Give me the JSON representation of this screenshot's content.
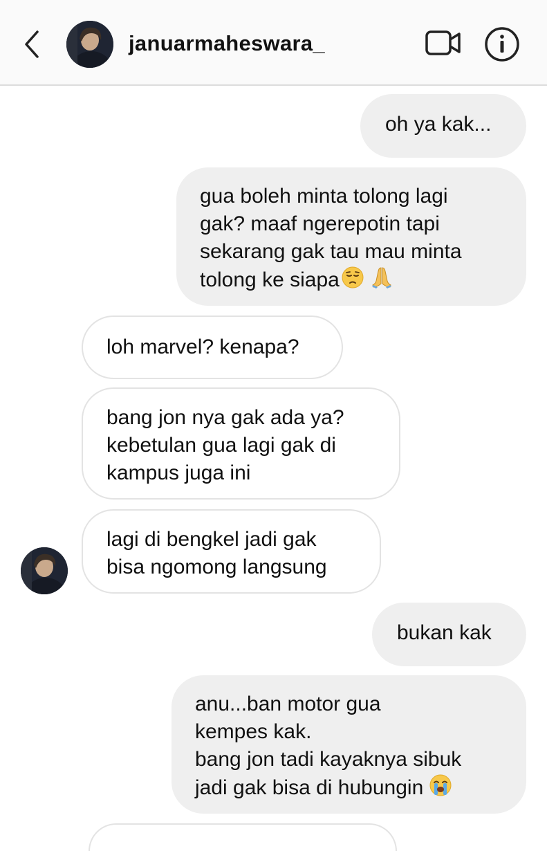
{
  "header": {
    "username": "januarmaheswara_",
    "icons": [
      "chevron-left-icon",
      "video-camera-icon",
      "info-icon"
    ]
  },
  "messages": [
    {
      "from": "me",
      "lines": [
        "oh ya kak..."
      ]
    },
    {
      "from": "me",
      "lines": [
        "gua boleh minta tolong lagi",
        "gak? maaf ngerepotin tapi",
        "sekarang gak tau mau minta",
        "tolong ke siapa"
      ],
      "emojis": [
        "pensive-face-icon",
        "folded-hands-icon"
      ]
    },
    {
      "from": "them",
      "lines": [
        "loh marvel? kenapa?"
      ]
    },
    {
      "from": "them",
      "lines": [
        "bang jon nya gak ada ya?",
        "kebetulan gua lagi gak di",
        "kampus juga ini"
      ]
    },
    {
      "from": "them",
      "lines": [
        "lagi di bengkel jadi gak",
        "bisa ngomong langsung"
      ]
    },
    {
      "from": "me",
      "lines": [
        "bukan kak"
      ]
    },
    {
      "from": "me",
      "lines": [
        "anu...ban motor gua",
        "kempes kak.",
        "bang jon tadi kayaknya sibuk",
        "jadi gak bisa di hubungin"
      ],
      "emojis": [
        "loudly-crying-face-icon"
      ]
    }
  ],
  "colors": {
    "sent_bubble": "#efefef",
    "received_border": "#e3e3e3",
    "header_bg": "#fafafa"
  }
}
